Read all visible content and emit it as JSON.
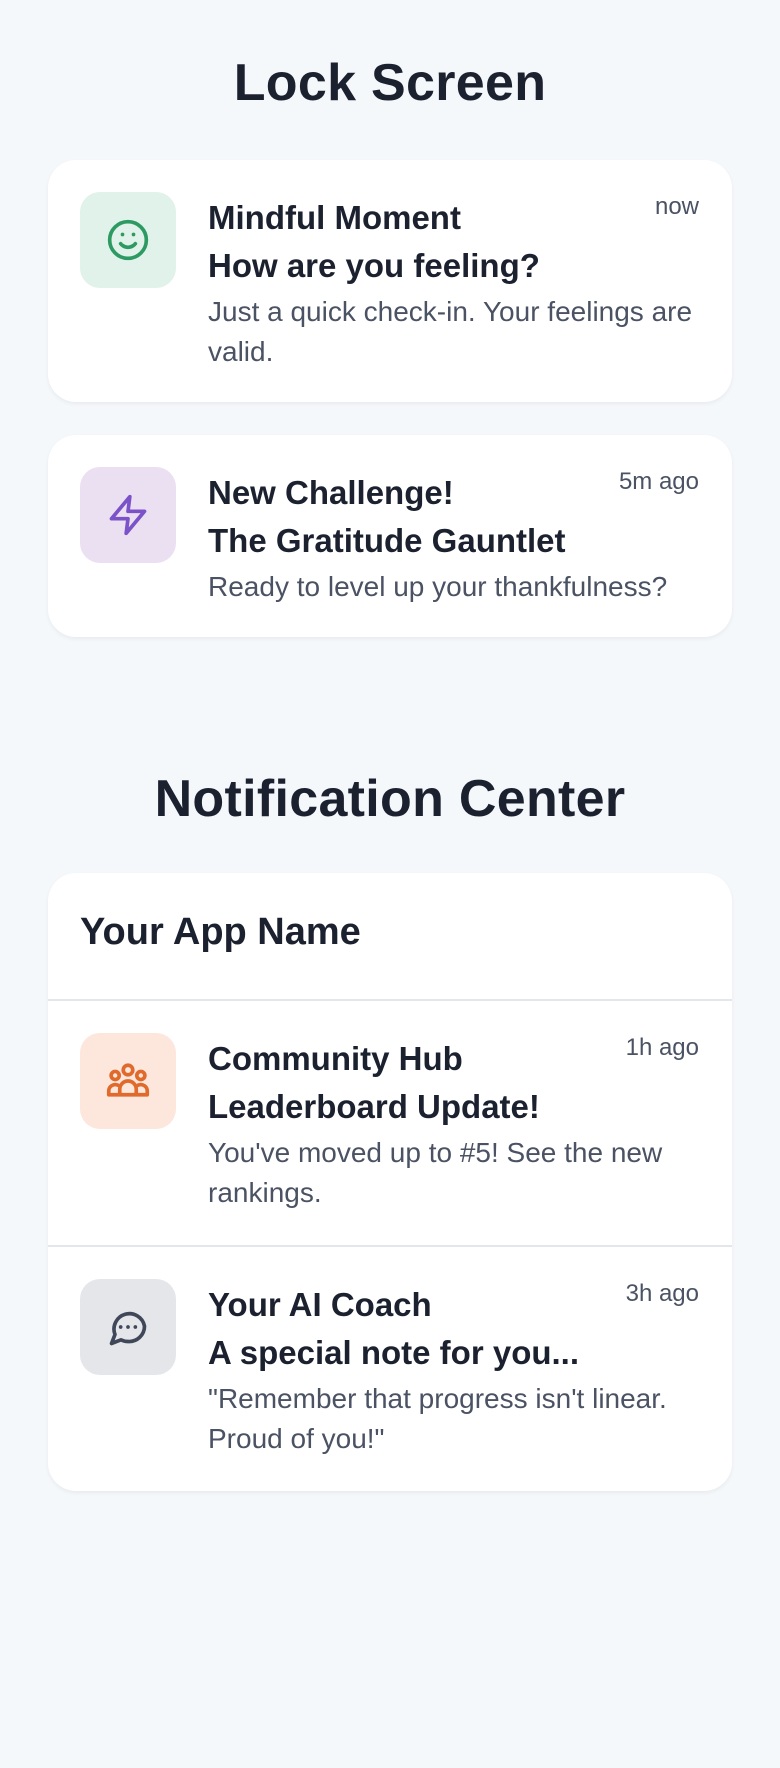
{
  "lock_screen": {
    "title": "Lock Screen",
    "notifications": [
      {
        "app": "Mindful Moment",
        "title": "How are you feeling?",
        "text": "Just a quick check-in. Your feelings are valid.",
        "time": "now",
        "icon": "smiley-icon",
        "icon_bg": "#e0f2e9",
        "icon_color": "#2e9a63"
      },
      {
        "app": "New Challenge!",
        "title": "The Gratitude Gauntlet",
        "text": "Ready to level up your thankfulness?",
        "time": "5m ago",
        "icon": "lightning-icon",
        "icon_bg": "#ebe0f1",
        "icon_color": "#7b52c7"
      }
    ]
  },
  "notification_center": {
    "title": "Notification Center",
    "app_name": "Your App Name",
    "notifications": [
      {
        "app": "Community Hub",
        "title": "Leaderboard Update!",
        "text": "You've moved up to #5! See the new rankings.",
        "time": "1h ago",
        "icon": "group-icon",
        "icon_bg": "#fde6dc",
        "icon_color": "#e06a2c"
      },
      {
        "app": "Your AI Coach",
        "title": "A special note for you...",
        "text": "\"Remember that progress isn't linear. Proud of you!\"",
        "time": "3h ago",
        "icon": "chat-bubble-icon",
        "icon_bg": "#e4e6ea",
        "icon_color": "#3f4758"
      }
    ]
  }
}
